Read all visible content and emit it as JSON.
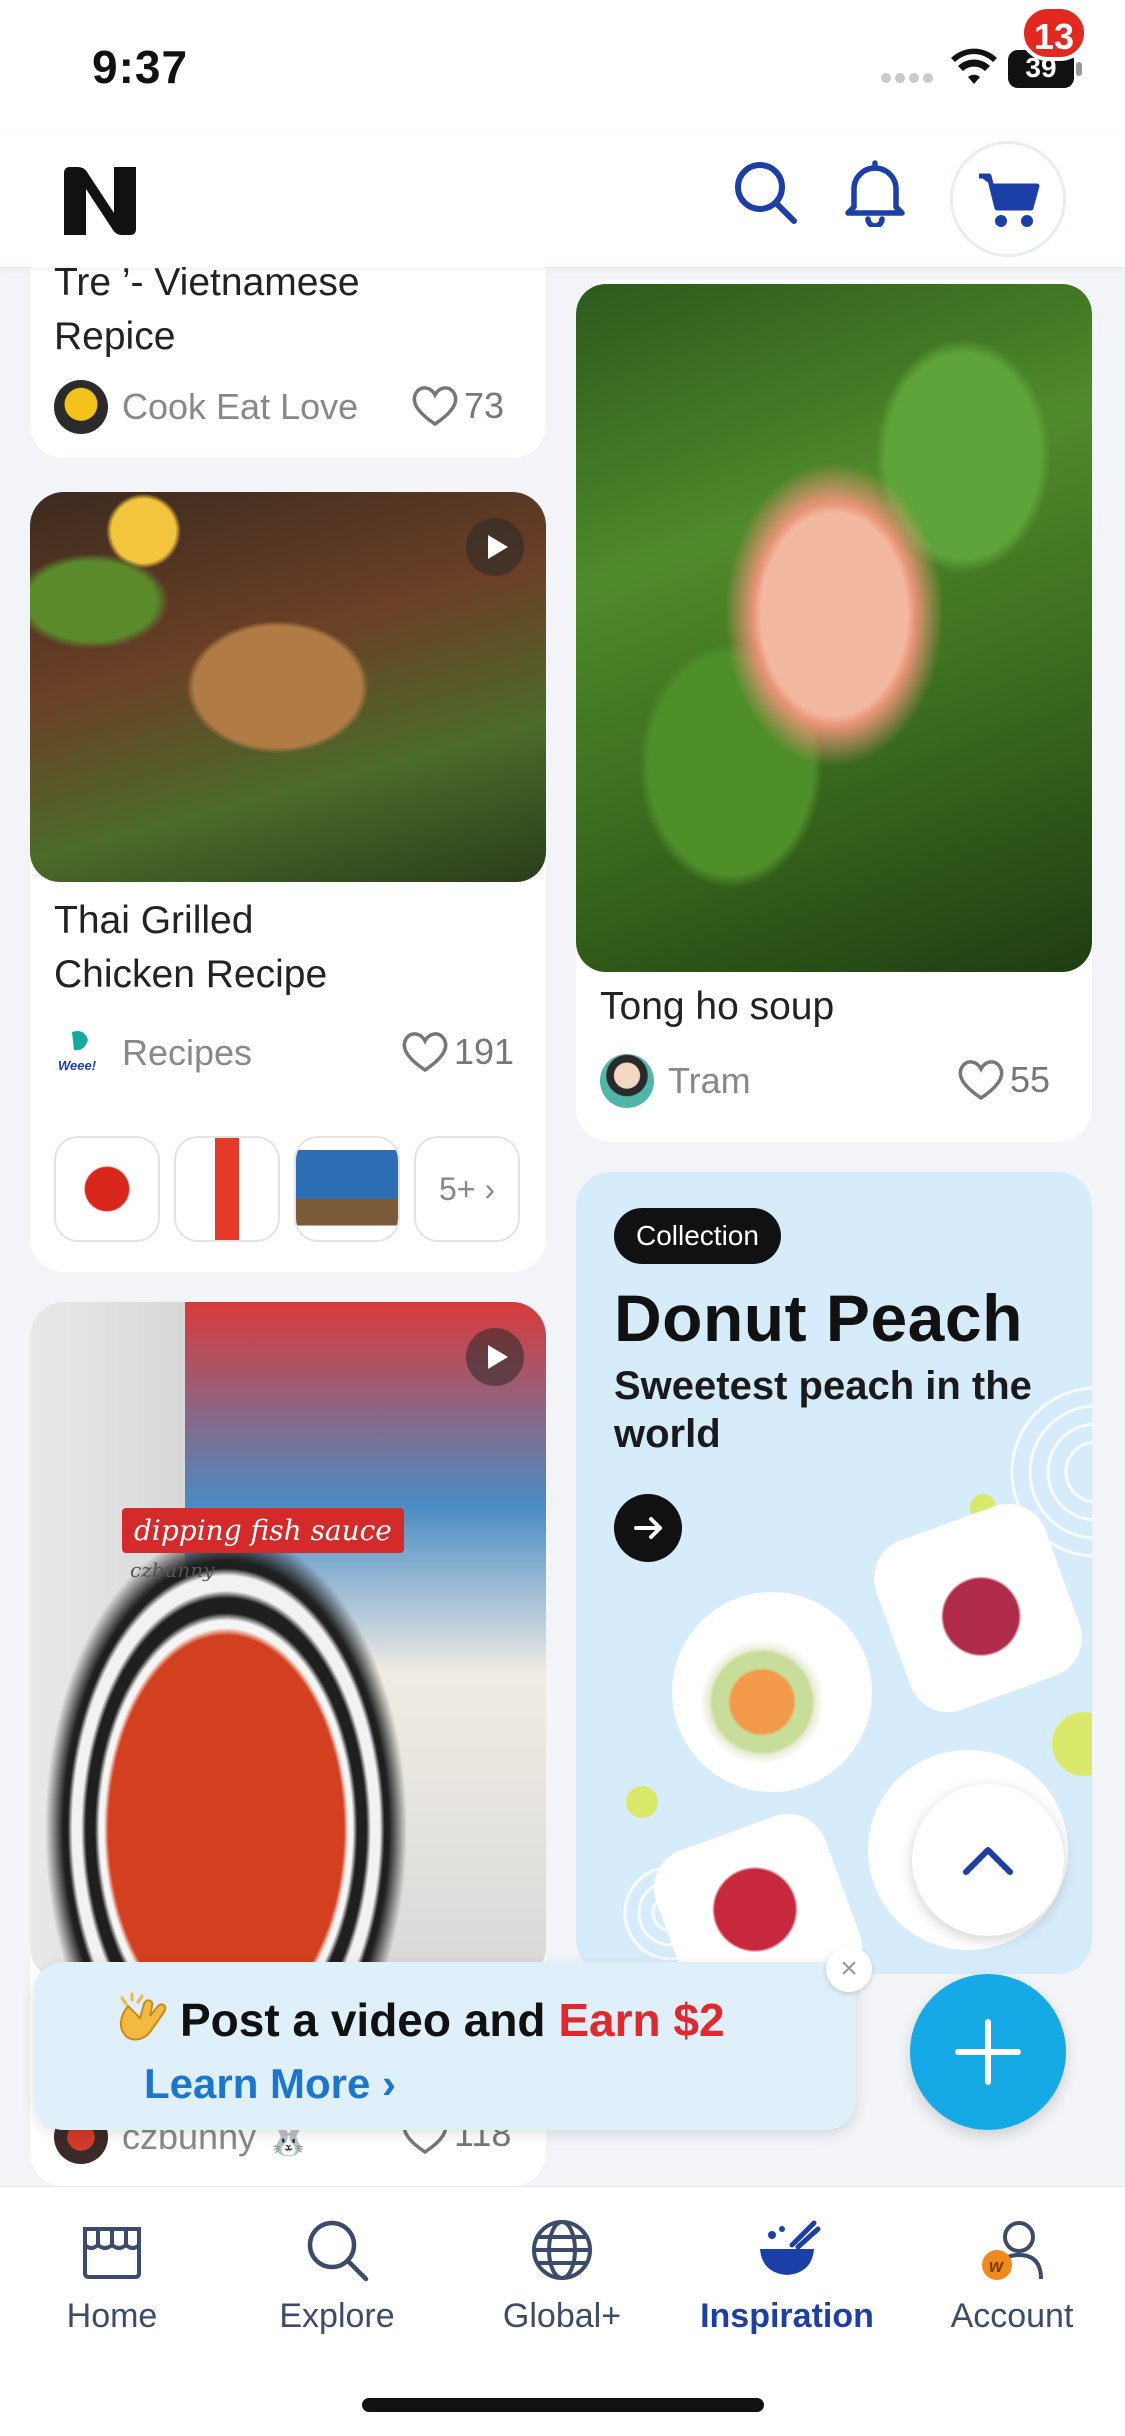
{
  "status_bar": {
    "time": "9:37",
    "battery": "39"
  },
  "header": {
    "logo_text": "N",
    "cart_badge": "13",
    "icons": [
      "search-icon",
      "bell-icon",
      "cart-icon"
    ]
  },
  "feed": {
    "left": [
      {
        "title_line1": "Tre ’- Vietnamese",
        "title_line2": "Repice",
        "author": "Cook Eat Love",
        "likes": "73"
      },
      {
        "title_line1": "Thai Grilled",
        "title_line2": "Chicken Recipe",
        "author": "Recipes",
        "author_logo": "Weee!",
        "likes": "191",
        "more_products": "5+ ›"
      },
      {
        "image_caption": "dipping fish sauce",
        "image_caption_small": "czbunny",
        "author": "czbunny 🐰",
        "likes": "118"
      }
    ],
    "right": [
      {
        "title": "Tong ho soup",
        "author": "Tram",
        "likes": "55"
      }
    ],
    "collection": {
      "tag": "Collection",
      "title": "Donut Peach",
      "subtitle": "Sweetest peach in the world"
    }
  },
  "promo": {
    "text_prefix": "Post a video and ",
    "text_highlight": "Earn $2",
    "link": "Learn More ›",
    "close": "×"
  },
  "tabbar": {
    "tabs": [
      {
        "label": "Home",
        "icon": "store-icon"
      },
      {
        "label": "Explore",
        "icon": "search-icon"
      },
      {
        "label": "Global+",
        "icon": "globe-icon"
      },
      {
        "label": "Inspiration",
        "icon": "bowl-icon",
        "active": true
      },
      {
        "label": "Account",
        "icon": "user-icon"
      }
    ]
  },
  "colors": {
    "brand_blue": "#1b3fa6",
    "badge_red": "#e3291f",
    "fab_blue": "#15aae6",
    "earn_red": "#e0282d",
    "link_blue": "#1b76cf"
  }
}
